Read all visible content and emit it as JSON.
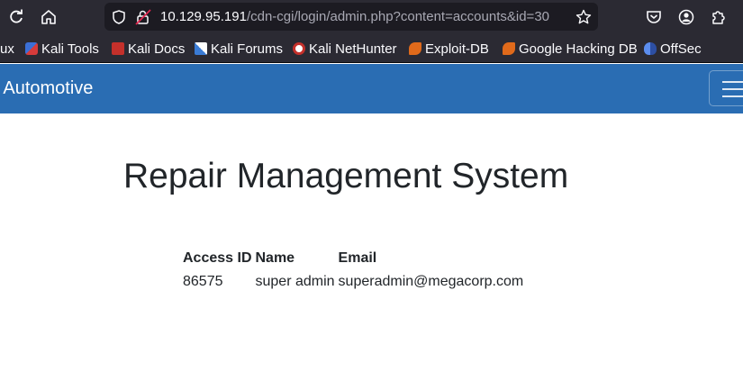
{
  "browser": {
    "url": {
      "host": "10.129.95.191",
      "path": "/cdn-cgi/login/admin.php?content=accounts&id=30"
    },
    "bookmarks": [
      {
        "label": "ux",
        "icon": "linux-icon"
      },
      {
        "label": "Kali Tools",
        "icon": "kali-tools-icon"
      },
      {
        "label": "Kali Docs",
        "icon": "kali-docs-icon"
      },
      {
        "label": "Kali Forums",
        "icon": "kali-forums-icon"
      },
      {
        "label": "Kali NetHunter",
        "icon": "kali-nethunter-icon"
      },
      {
        "label": "Exploit-DB",
        "icon": "exploit-db-icon"
      },
      {
        "label": "Google Hacking DB",
        "icon": "ghdb-icon"
      },
      {
        "label": "OffSec",
        "icon": "offsec-icon"
      }
    ]
  },
  "navbar": {
    "brand": "orp Automotive",
    "color": "#2a6db3"
  },
  "main": {
    "title": "Repair Management System",
    "table": {
      "headers": [
        "Access ID",
        "Name",
        "Email"
      ],
      "rows": [
        [
          "86575",
          "super admin",
          "superadmin@megacorp.com"
        ]
      ]
    }
  }
}
